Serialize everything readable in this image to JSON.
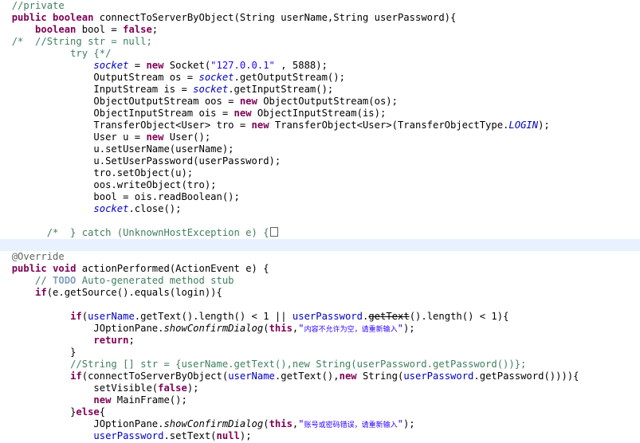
{
  "code": {
    "l01_comment": "//private",
    "l02_kw": "public boolean",
    "l02_rest": " connectToServerByObject(String userName,String userPassword){",
    "l03_kw1": "boolean",
    "l03_mid": " bool = ",
    "l03_kw2": "false",
    "l03_end": ";",
    "l04_comment": "/*  //String str = null;",
    "l05_comment": "try {*/",
    "l06_field": "socket",
    "l06_mid": " = ",
    "l06_kw": "new",
    "l06_mid2": " Socket(",
    "l06_str": "\"127.0.0.1\"",
    "l06_end": " , 5888);",
    "l07_a": "OutputStream os = ",
    "l07_field": "socket",
    "l07_b": ".getOutputStream();",
    "l08_a": "InputStream is = ",
    "l08_field": "socket",
    "l08_b": ".getInputStream();",
    "l09_a": "ObjectOutputStream oos = ",
    "l09_kw": "new",
    "l09_b": " ObjectOutputStream(os);",
    "l10_a": "ObjectInputStream ois = ",
    "l10_kw": "new",
    "l10_b": " ObjectInputStream(is);",
    "l11_a": "TransferObject<User> tro = ",
    "l11_kw": "new",
    "l11_b": " TransferObject<User>(TransferObjectType.",
    "l11_const": "LOGIN",
    "l11_c": ");",
    "l12_a": "User u = ",
    "l12_kw": "new",
    "l12_b": " User();",
    "l13": "u.setUserName(userName);",
    "l14": "u.SetUserPassword(userPassword);",
    "l15": "tro.setObject(u);",
    "l16": "oos.writeObject(tro);",
    "l17": "bool = ois.readBoolean();",
    "l18_field": "socket",
    "l18_b": ".close();",
    "l19_comment": "/*  } catch (UnknownHostException e) {",
    "l20_ann": "@Override",
    "l21_kw1": "public",
    "l21_kw2": "void",
    "l21_rest": " actionPerformed(ActionEvent e) {",
    "l22_a": "// ",
    "l22_todo": "TODO",
    "l22_b": " Auto-generated method stub",
    "l23_kw": "if",
    "l23_b": "(e.getSource().equals(login)){",
    "l24_kw": "if",
    "l24_a": "(",
    "l24_f1": "userName",
    "l24_b": ".getText().length() < 1 || ",
    "l24_f2": "userPassword",
    "l24_dot": ".",
    "l24_strike": "getText",
    "l24_c": "().length() < 1){",
    "l25_a": "JOptionPane.",
    "l25_m": "showConfirmDialog",
    "l25_b": "(",
    "l25_kw": "this",
    "l25_c": ",",
    "l25_str1": "\"",
    "l25_cjk": "内容不允许为空，请重新输入",
    "l25_str2": "\"",
    "l25_d": ");",
    "l26_kw": "return",
    "l26_b": ";",
    "l27": "}",
    "l28_comment": "//String [] str = {userName.getText(),new String(userPassword.getPassword())};",
    "l29_kw1": "if",
    "l29_a": "(connectToServerByObject(",
    "l29_f1": "userName",
    "l29_b": ".getText(),",
    "l29_kw2": "new",
    "l29_c": " String(",
    "l29_f2": "userPassword",
    "l29_d": ".getPassword()))){",
    "l30_a": "setVisible(",
    "l30_kw": "false",
    "l30_b": ");",
    "l31_kw": "new",
    "l31_b": " MainFrame();",
    "l32_a": "}",
    "l32_kw": "else",
    "l32_b": "{",
    "l33_a": "JOptionPane.",
    "l33_m": "showConfirmDialog",
    "l33_b": "(",
    "l33_kw": "this",
    "l33_c": ",",
    "l33_str1": "\"",
    "l33_cjk": "账号或密码错误，请重新输入",
    "l33_str2": "\"",
    "l33_d": ");",
    "l34_f": "userPassword",
    "l34_a": ".setText(",
    "l34_kw": "null",
    "l34_b": ");"
  }
}
